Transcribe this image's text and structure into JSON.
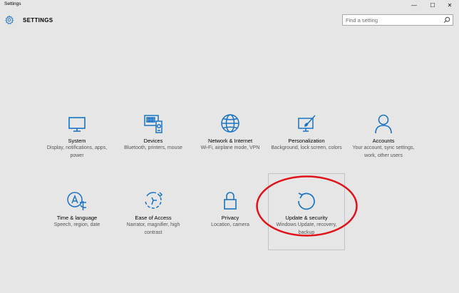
{
  "window": {
    "title": "Settings",
    "minimize": "—",
    "maximize": "☐",
    "close": "✕"
  },
  "header": {
    "title": "SETTINGS",
    "search_placeholder": "Find a setting"
  },
  "tiles": [
    {
      "label": "System",
      "desc": "Display, notifications, apps, power",
      "icon": "monitor-icon"
    },
    {
      "label": "Devices",
      "desc": "Bluetooth, printers, mouse",
      "icon": "devices-icon"
    },
    {
      "label": "Network & Internet",
      "desc": "Wi-Fi, airplane mode, VPN",
      "icon": "globe-icon"
    },
    {
      "label": "Personalization",
      "desc": "Background, lock screen, colors",
      "icon": "paint-icon"
    },
    {
      "label": "Accounts",
      "desc": "Your account, sync settings, work, other users",
      "icon": "person-icon"
    },
    {
      "label": "Time & language",
      "desc": "Speech, region, date",
      "icon": "language-icon"
    },
    {
      "label": "Ease of Access",
      "desc": "Narrator, magnifier, high contrast",
      "icon": "ease-of-access-icon"
    },
    {
      "label": "Privacy",
      "desc": "Location, camera",
      "icon": "lock-icon"
    },
    {
      "label": "Update & security",
      "desc": "Windows Update, recovery, backup",
      "icon": "refresh-icon"
    }
  ],
  "colors": {
    "accent": "#1a73c8",
    "annotation": "#e0131b",
    "background": "#e6e6e6"
  }
}
